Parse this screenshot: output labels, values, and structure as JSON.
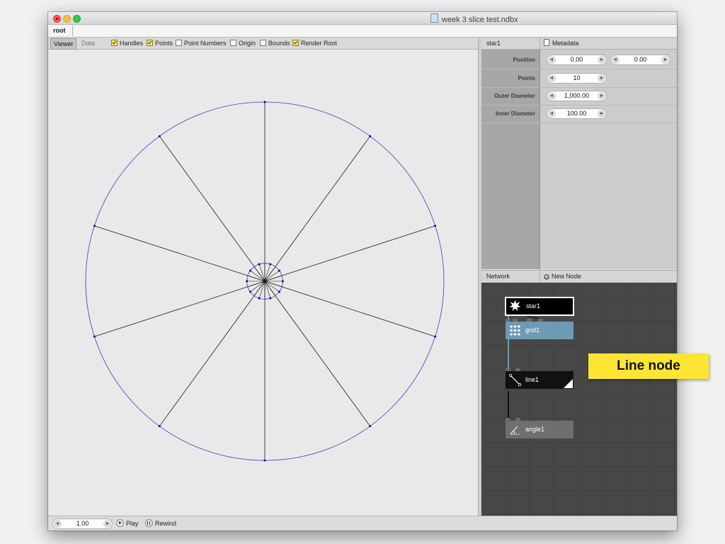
{
  "window": {
    "title": "week 3 slice test.ndbx",
    "traffic_lights": [
      "close",
      "minimize",
      "zoom"
    ]
  },
  "breadcrumb": {
    "items": [
      "root"
    ]
  },
  "viewer_toolbar": {
    "tabs": [
      {
        "label": "Viewer",
        "active": true
      },
      {
        "label": "Data",
        "active": false
      }
    ],
    "options": [
      {
        "label": "Handles",
        "checked": true
      },
      {
        "label": "Points",
        "checked": true
      },
      {
        "label": "Point Numbers",
        "checked": false
      },
      {
        "label": "Origin",
        "checked": false
      },
      {
        "label": "Bounds",
        "checked": false
      },
      {
        "label": "Render Root",
        "checked": true
      }
    ]
  },
  "canvas": {
    "shape": "star",
    "points": 10,
    "outer_diameter": 1000,
    "inner_diameter": 100,
    "stroke_color": "#1a1a1a",
    "outline_color": "#3b3bbf",
    "point_color": "#0000cc"
  },
  "inspector": {
    "node_name": "star1",
    "metadata_label": "Metadata",
    "params": [
      {
        "label": "Position",
        "values": [
          "0.00",
          "0.00"
        ]
      },
      {
        "label": "Points",
        "values": [
          "10"
        ]
      },
      {
        "label": "Outer Diameter",
        "values": [
          "1,000.00"
        ]
      },
      {
        "label": "Inner Diameter",
        "values": [
          "100.00"
        ]
      }
    ]
  },
  "network": {
    "title": "Network",
    "new_node_label": "New Node",
    "nodes": [
      {
        "name": "star1",
        "icon": "star-icon",
        "style": "rendered",
        "color": "#000000"
      },
      {
        "name": "grid1",
        "icon": "grid-icon",
        "style": "selected",
        "color": "#6e9ab4"
      },
      {
        "name": "line1",
        "icon": "line-icon",
        "style": "normal",
        "color": "#111111"
      },
      {
        "name": "angle1",
        "icon": "angle-icon",
        "style": "normal",
        "color": "#6f6f6f"
      }
    ]
  },
  "bottom_bar": {
    "frame_value": "1.00",
    "play_label": "Play",
    "rewind_label": "Rewind"
  },
  "callout": {
    "text": "Line node",
    "color": "#fde534"
  }
}
